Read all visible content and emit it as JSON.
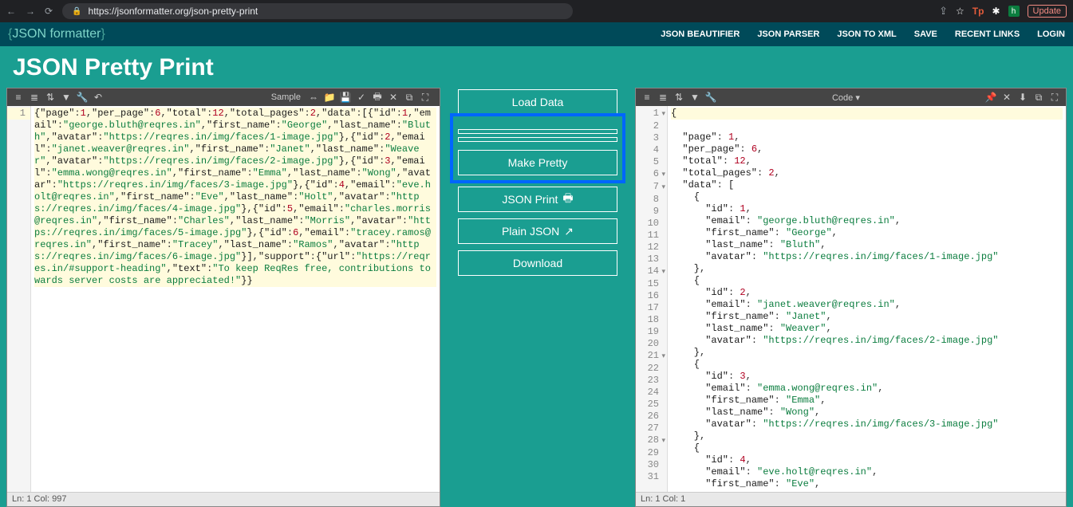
{
  "browser": {
    "url": "https://jsonformatter.org/json-pretty-print",
    "update_label": "Update"
  },
  "header": {
    "logo_text": "JSON formatter",
    "nav": [
      "JSON BEAUTIFIER",
      "JSON PARSER",
      "JSON TO XML",
      "SAVE",
      "RECENT LINKS",
      "LOGIN"
    ]
  },
  "page_title": "JSON Pretty Print",
  "left_toolbar": {
    "label": "Sample"
  },
  "right_toolbar": {
    "label": "Code"
  },
  "buttons": {
    "load": "Load Data",
    "make_pretty": "Make Pretty",
    "json_print": "JSON Print",
    "plain_json": "Plain JSON",
    "download": "Download"
  },
  "left_status": "Ln: 1  Col: 997",
  "right_status": "Ln: 1  Col: 1",
  "input_json_raw": "{\"page\":1,\"per_page\":6,\"total\":12,\"total_pages\":2,\"data\":[{\"id\":1,\"email\":\"george.bluth@reqres.in\",\"first_name\":\"George\",\"last_name\":\"Bluth\",\"avatar\":\"https://reqres.in/img/faces/1-image.jpg\"},{\"id\":2,\"email\":\"janet.weaver@reqres.in\",\"first_name\":\"Janet\",\"last_name\":\"Weaver\",\"avatar\":\"https://reqres.in/img/faces/2-image.jpg\"},{\"id\":3,\"email\":\"emma.wong@reqres.in\",\"first_name\":\"Emma\",\"last_name\":\"Wong\",\"avatar\":\"https://reqres.in/img/faces/3-image.jpg\"},{\"id\":4,\"email\":\"eve.holt@reqres.in\",\"first_name\":\"Eve\",\"last_name\":\"Holt\",\"avatar\":\"https://reqres.in/img/faces/4-image.jpg\"},{\"id\":5,\"email\":\"charles.morris@reqres.in\",\"first_name\":\"Charles\",\"last_name\":\"Morris\",\"avatar\":\"https://reqres.in/img/faces/5-image.jpg\"},{\"id\":6,\"email\":\"tracey.ramos@reqres.in\",\"first_name\":\"Tracey\",\"last_name\":\"Ramos\",\"avatar\":\"https://reqres.in/img/faces/6-image.jpg\"}],\"support\":{\"url\":\"https://reqres.in/#support-heading\",\"text\":\"To keep ReqRes free, contributions towards server costs are appreciated!\"}}",
  "output_json": {
    "page": 1,
    "per_page": 6,
    "total": 12,
    "total_pages": 2,
    "data": [
      {
        "id": 1,
        "email": "george.bluth@reqres.in",
        "first_name": "George",
        "last_name": "Bluth",
        "avatar": "https://reqres.in/img/faces/1-image.jpg"
      },
      {
        "id": 2,
        "email": "janet.weaver@reqres.in",
        "first_name": "Janet",
        "last_name": "Weaver",
        "avatar": "https://reqres.in/img/faces/2-image.jpg"
      },
      {
        "id": 3,
        "email": "emma.wong@reqres.in",
        "first_name": "Emma",
        "last_name": "Wong",
        "avatar": "https://reqres.in/img/faces/3-image.jpg"
      },
      {
        "id": 4,
        "email": "eve.holt@reqres.in",
        "first_name": "Eve",
        "last_name": "Holt",
        "avatar": "https://reqres.in/img/faces/4-image.jpg"
      },
      {
        "id": 5,
        "email": "charles.morris@reqres.in",
        "first_name": "Charles",
        "last_name": "Morris",
        "avatar": "https://reqres.in/img/faces/5-image.jpg"
      },
      {
        "id": 6,
        "email": "tracey.ramos@reqres.in",
        "first_name": "Tracey",
        "last_name": "Ramos",
        "avatar": "https://reqres.in/img/faces/6-image.jpg"
      }
    ],
    "support": {
      "url": "https://reqres.in/#support-heading",
      "text": "To keep ReqRes free, contributions towards server costs are appreciated!"
    }
  },
  "output_visible_lines": 31
}
